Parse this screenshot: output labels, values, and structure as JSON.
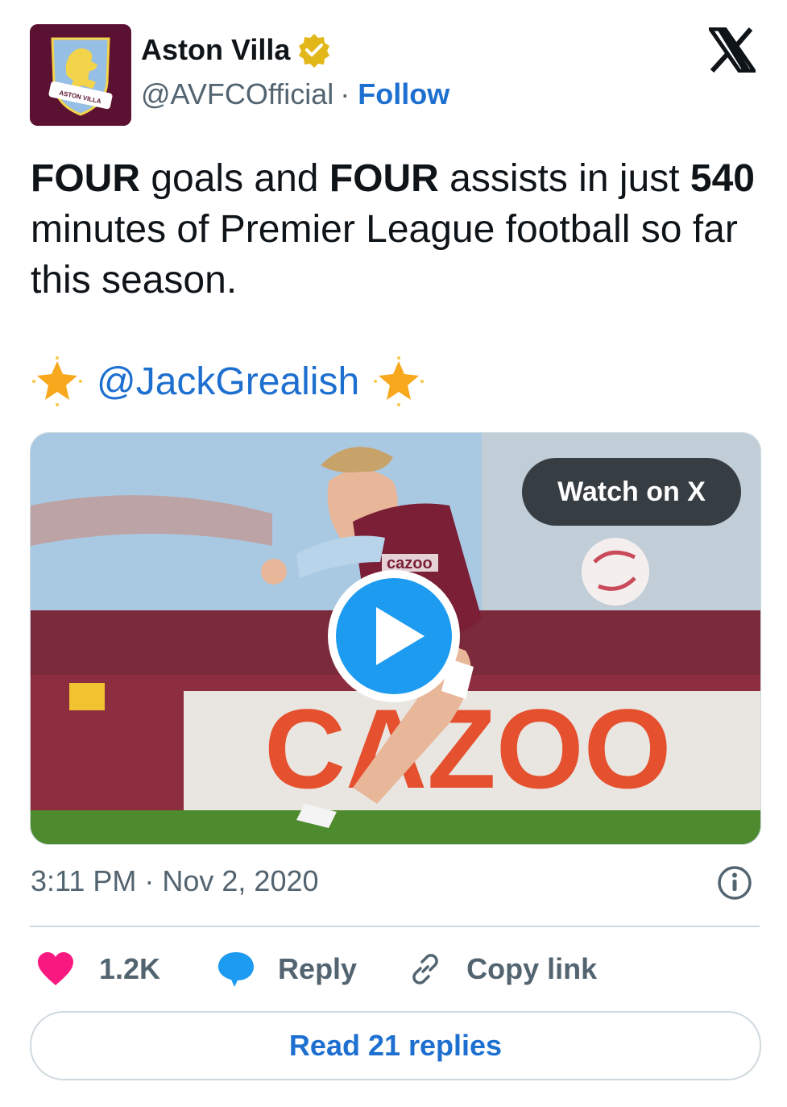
{
  "author": {
    "name": "Aston Villa",
    "handle": "@AVFCOfficial",
    "separator": "·",
    "follow_label": "Follow",
    "crest_text": "ASTON VILLA"
  },
  "tweet": {
    "parts": [
      "FOUR",
      " goals and ",
      "FOUR",
      " assists in just ",
      "540",
      " minutes of Premier League football so far this season."
    ],
    "mention": "@JackGrealish"
  },
  "media": {
    "watch_label": "Watch on X",
    "board_text": "CAZOO",
    "shirt_text": "cazoo"
  },
  "meta": {
    "timestamp": "3:11 PM · Nov 2, 2020"
  },
  "actions": {
    "likes": "1.2K",
    "reply_label": "Reply",
    "copy_link_label": "Copy link"
  },
  "read_replies_label": "Read 21 replies",
  "colors": {
    "link_blue": "#1d6fd0",
    "like_pink": "#f91880",
    "reply_blue": "#1d9bf0",
    "verified_gold": "#e2b719",
    "club_claret": "#5b1131"
  }
}
